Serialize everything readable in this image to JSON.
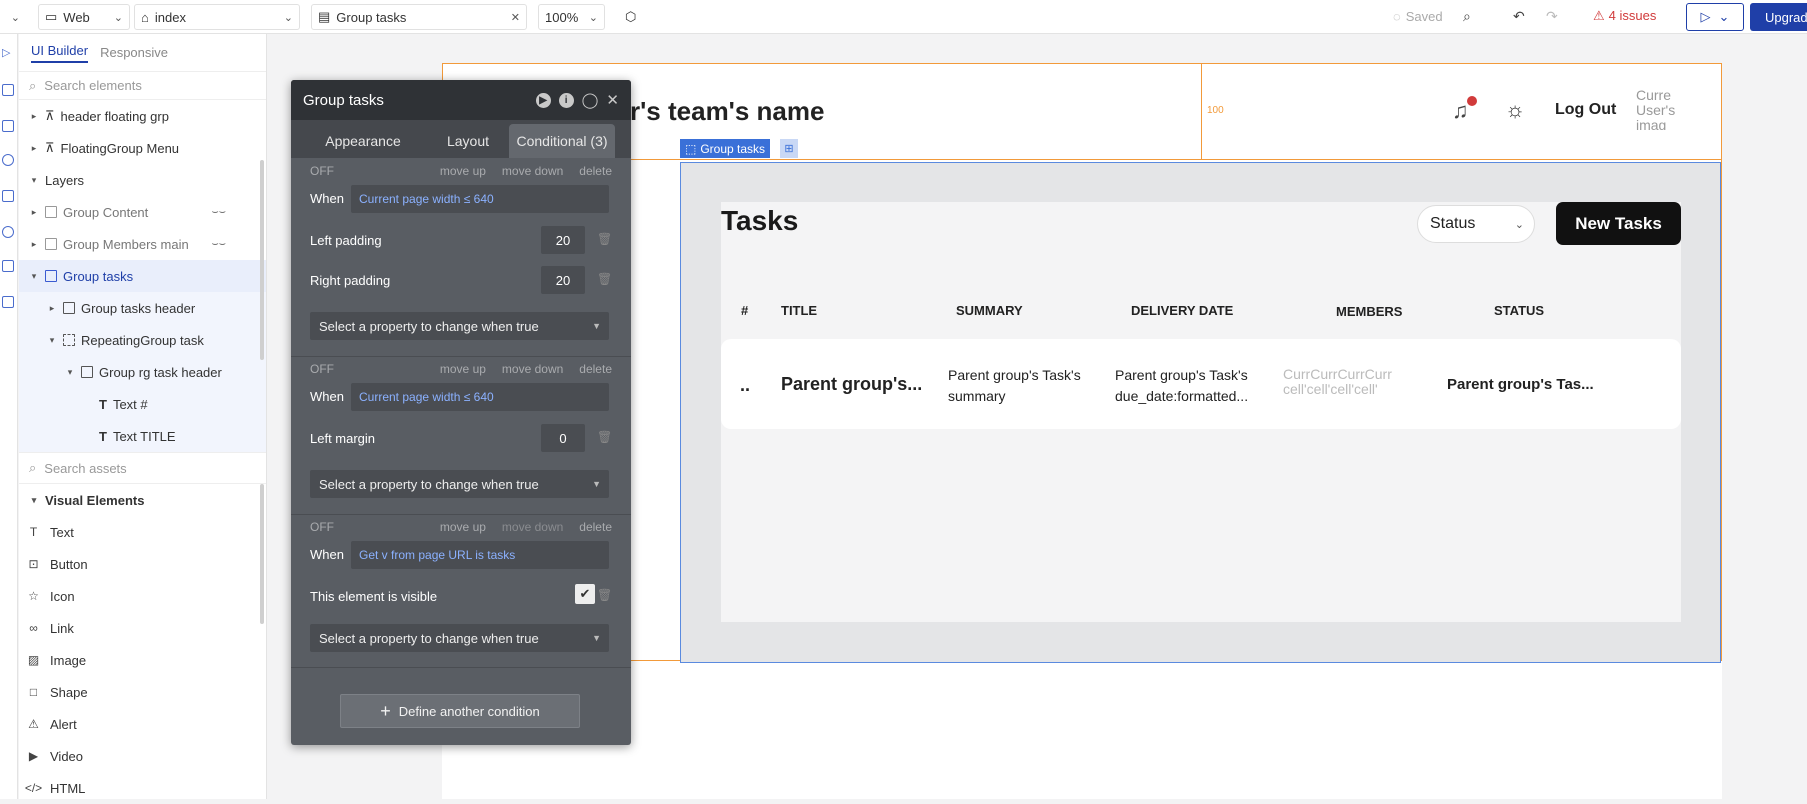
{
  "topbar": {
    "platform": "Web",
    "page": "index",
    "element_tab": "Group tasks",
    "zoom": "100%",
    "saved": "Saved",
    "issues": "4 issues",
    "upgrade": "Upgrad"
  },
  "left_panel": {
    "tabs": [
      "UI Builder",
      "Responsive"
    ],
    "search_elements_placeholder": "Search elements",
    "tree": {
      "header_floating": "header floating grp",
      "floating_menu": "FloatingGroup Menu",
      "layers": "Layers",
      "group_content": "Group Content",
      "group_members": "Group Members main",
      "group_tasks": "Group tasks",
      "group_tasks_header": "Group tasks header",
      "repeating_group": "RepeatingGroup task",
      "rg_header": "Group rg task header",
      "text_hash": "Text #",
      "text_title": "Text TITLE"
    },
    "search_assets_placeholder": "Search assets",
    "visual_elements_heading": "Visual Elements",
    "visual_elements": [
      "Text",
      "Button",
      "Icon",
      "Link",
      "Image",
      "Shape",
      "Alert",
      "Video",
      "HTML"
    ]
  },
  "dialog": {
    "title": "Group tasks",
    "tabs": [
      "Appearance",
      "Layout",
      "Conditional (3)"
    ],
    "off": "OFF",
    "move_up": "move up",
    "move_down": "move down",
    "delete": "delete",
    "when": "When",
    "cond1": {
      "expr": "Current page width ≤ 640",
      "left_padding_label": "Left padding",
      "left_padding": "20",
      "right_padding_label": "Right padding",
      "right_padding": "20"
    },
    "cond2": {
      "expr": "Current page width ≤ 640",
      "left_margin_label": "Left margin",
      "left_margin": "0"
    },
    "cond3": {
      "expr": "Get v from page URL is tasks",
      "visible_label": "This element is visible"
    },
    "select_property": "Select a property to change when true",
    "define_another": "Define another condition"
  },
  "canvas": {
    "header_title": "r's team's name",
    "marker_100": "100",
    "log_out": "Log Out",
    "avatar_alt": "Curre User's imag",
    "selected_tag": "Group tasks",
    "tasks_title": "Tasks",
    "status_select": "Status",
    "new_tasks_button": "New Tasks",
    "table_headers": [
      "#",
      "TITLE",
      "SUMMARY",
      "DELIVERY DATE",
      "MEMBERS",
      "STATUS"
    ],
    "row": {
      "num": "..",
      "title": "Parent group's...",
      "summary": "Parent group's Task's summary",
      "delivery": "Parent group's Task's due_date:formatted...",
      "members": "CurrCurrCurrCurr cell'cell'cell'cell'",
      "status": "Parent group's Tas..."
    }
  },
  "colors": {
    "accent_blue": "#1f3fa8",
    "issues_red": "#d13b3b",
    "selection_blue": "#3a70d8",
    "orange_outline": "#f29a3a"
  }
}
